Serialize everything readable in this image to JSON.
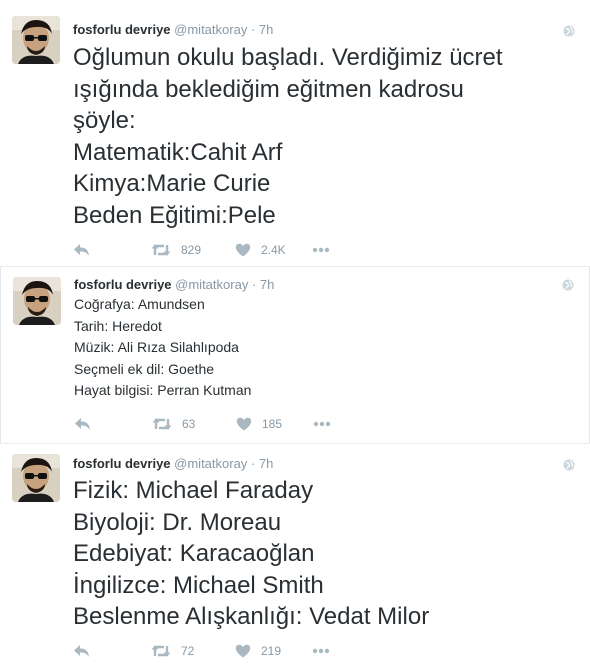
{
  "tweets": [
    {
      "name": "fosforlu devriye",
      "handle": "@mitatkoray",
      "separator": "·",
      "time": "7h",
      "lines": [
        "Oğlumun okulu başladı. Verdiğimiz ücret",
        "ışığında beklediğim eğitmen kadrosu",
        "şöyle:",
        "Matematik:Cahit Arf",
        "Kimya:Marie Curie",
        "Beden Eğitimi:Pele"
      ],
      "retweets": "829",
      "likes": "2.4K"
    },
    {
      "name": "fosforlu devriye",
      "handle": "@mitatkoray",
      "separator": "·",
      "time": "7h",
      "lines": [
        "Coğrafya: Amundsen",
        "Tarih: Heredot",
        "Müzik: Ali Rıza Silahlıpoda",
        "Seçmeli ek dil: Goethe",
        "Hayat bilgisi: Perran Kutman"
      ],
      "retweets": "63",
      "likes": "185"
    },
    {
      "name": "fosforlu devriye",
      "handle": "@mitatkoray",
      "separator": "·",
      "time": "7h",
      "lines": [
        "Fizik: Michael Faraday",
        "Biyoloji: Dr. Moreau",
        "Edebiyat: Karacaoğlan",
        "İngilizce: Michael Smith",
        "Beslenme Alışkanlığı: Vedat Milor"
      ],
      "retweets": "72",
      "likes": "219"
    }
  ],
  "icons": {
    "reply": "reply-icon",
    "retweet": "retweet-icon",
    "like": "heart-icon",
    "more": "more-icon",
    "globe": "globe-icon"
  },
  "colors": {
    "muted": "#8899a6",
    "text": "#292f33",
    "background": "#e6ecf0"
  }
}
